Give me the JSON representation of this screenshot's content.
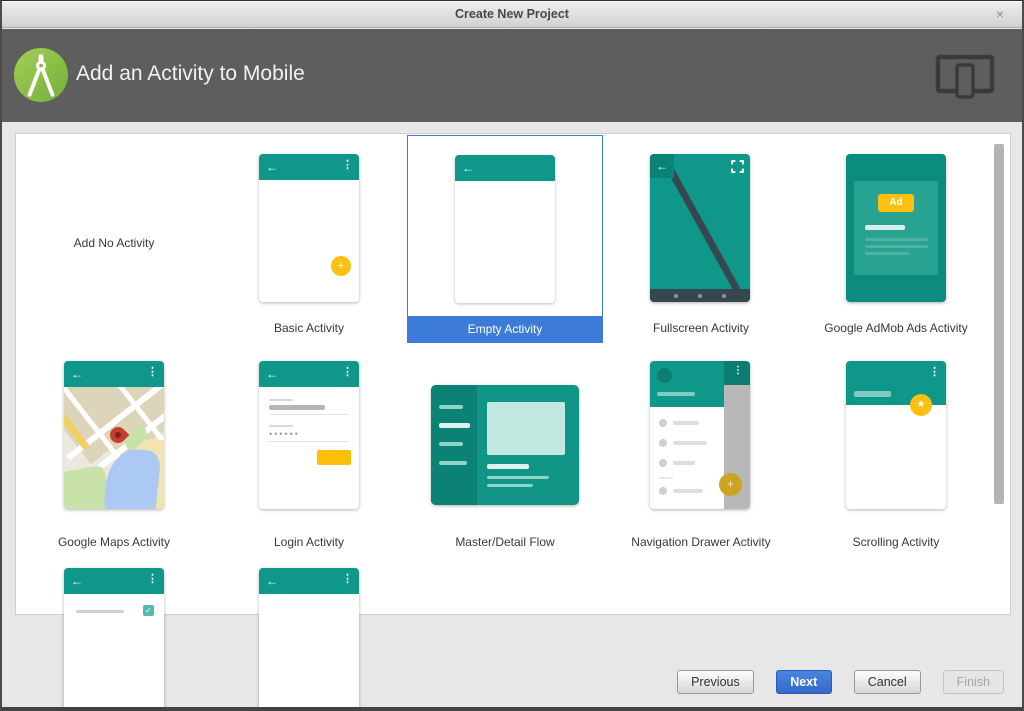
{
  "window": {
    "title": "Create New Project"
  },
  "icons": {
    "close": "×",
    "back": "←",
    "kebab": "⋮",
    "plus": "+",
    "star": "★",
    "check": "✓"
  },
  "header": {
    "title": "Add an Activity to Mobile"
  },
  "gallery": {
    "items": [
      {
        "label": "Add No Activity",
        "selected": false
      },
      {
        "label": "Basic Activity",
        "selected": false
      },
      {
        "label": "Empty Activity",
        "selected": true
      },
      {
        "label": "Fullscreen Activity",
        "selected": false
      },
      {
        "label": "Google AdMob Ads Activity",
        "ad_badge": "Ad",
        "selected": false
      },
      {
        "label": "Google Maps Activity",
        "selected": false
      },
      {
        "label": "Login Activity",
        "selected": false
      },
      {
        "label": "Master/Detail Flow",
        "selected": false
      },
      {
        "label": "Navigation Drawer Activity",
        "selected": false
      },
      {
        "label": "Scrolling Activity",
        "selected": false
      }
    ]
  },
  "footer": {
    "buttons": [
      {
        "label": "Previous",
        "state": "enabled"
      },
      {
        "label": "Next",
        "state": "primary"
      },
      {
        "label": "Cancel",
        "state": "enabled"
      },
      {
        "label": "Finish",
        "state": "disabled"
      }
    ]
  },
  "colors": {
    "teal": "#0f9789",
    "teal_dark": "#0b8276",
    "amber": "#fcc10e",
    "selection_blue": "#3d7bd9",
    "header_gray": "#5e5e5e"
  }
}
